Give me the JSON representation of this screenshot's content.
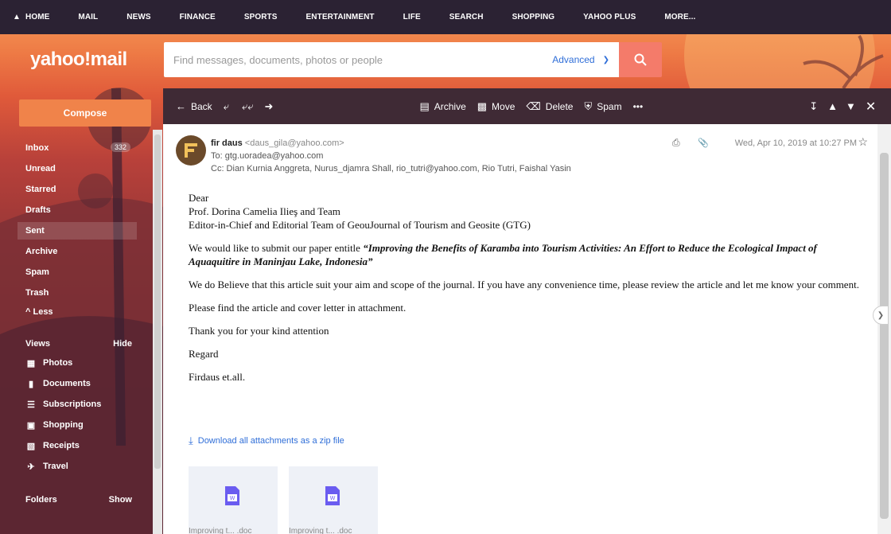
{
  "topnav": {
    "items": [
      {
        "label": "HOME",
        "icon": "home-icon"
      },
      {
        "label": "MAIL"
      },
      {
        "label": "NEWS"
      },
      {
        "label": "FINANCE"
      },
      {
        "label": "SPORTS"
      },
      {
        "label": "ENTERTAINMENT"
      },
      {
        "label": "LIFE"
      },
      {
        "label": "SEARCH"
      },
      {
        "label": "SHOPPING"
      },
      {
        "label": "YAHOO PLUS"
      },
      {
        "label": "MORE..."
      }
    ]
  },
  "header": {
    "logo": "yahoo!mail",
    "search_placeholder": "Find messages, documents, photos or people",
    "advanced": "Advanced"
  },
  "sidebar": {
    "compose": "Compose",
    "folders": [
      {
        "label": "Inbox",
        "count": "332"
      },
      {
        "label": "Unread"
      },
      {
        "label": "Starred"
      },
      {
        "label": "Drafts"
      },
      {
        "label": "Sent",
        "selected": true
      },
      {
        "label": "Archive"
      },
      {
        "label": "Spam"
      },
      {
        "label": "Trash"
      },
      {
        "label": "^ Less"
      }
    ],
    "views_label": "Views",
    "views_toggle": "Hide",
    "views": [
      {
        "label": "Photos",
        "icon": "photos-icon"
      },
      {
        "label": "Documents",
        "icon": "documents-icon"
      },
      {
        "label": "Subscriptions",
        "icon": "subscriptions-icon"
      },
      {
        "label": "Shopping",
        "icon": "shopping-icon"
      },
      {
        "label": "Receipts",
        "icon": "receipts-icon"
      },
      {
        "label": "Travel",
        "icon": "travel-icon"
      }
    ],
    "folders_label": "Folders",
    "folders_toggle": "Show"
  },
  "toolbar": {
    "back": "Back",
    "archive": "Archive",
    "move": "Move",
    "delete": "Delete",
    "spam": "Spam",
    "more": "•••"
  },
  "message": {
    "from_name": "fir daus",
    "from_addr": "<daus_gila@yahoo.com>",
    "to": "To: gtg.uoradea@yahoo.com",
    "cc": "Cc: Dian Kurnia Anggreta,  Nurus_djamra Shall,  rio_tutri@yahoo.com,  Rio Tutri,  Faishal Yasin",
    "date": "Wed, Apr 10, 2019 at 10:27 PM",
    "body": {
      "greeting": "Dear",
      "line2": "Prof. Dorina Camelia Ilieş and Team",
      "line3": "Editor-in-Chief and Editorial Team of GeouJournal of Tourism and Geosite (GTG)",
      "para1_pre": "We would like to submit our paper entitle ",
      "para1_title": "“Improving the Benefits of Karamba into Tourism Activities: An Effort to Reduce the Ecological Impact of Aquaquitire in Maninjau Lake, Indonesia”",
      "para2": "We do Believe that this article suit your aim and scope of the journal. If you have any convenience time, please review the article and let me know your comment.",
      "para3": "Please find the article and cover letter in attachment.",
      "para4": "Thank you for your kind attention",
      "para5": "Regard",
      "para6": "Firdaus et.all."
    },
    "download_all": "Download all attachments as a zip file",
    "attachments": [
      {
        "name": "Improving t... .doc"
      },
      {
        "name": "Improving t... .doc"
      }
    ]
  },
  "colors": {
    "topnav_bg": "#2b2233",
    "compose": "#f0834a",
    "toolbar_bg": "#3f2a35",
    "link": "#2f6ed8"
  }
}
